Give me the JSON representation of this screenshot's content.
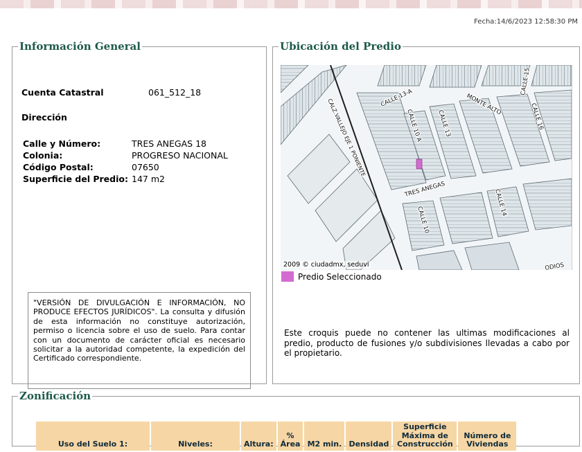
{
  "header": {
    "fecha": "Fecha:14/6/2023 12:58:30 PM"
  },
  "info": {
    "title": "Información General",
    "cuenta_label": "Cuenta Catastral",
    "cuenta_value": "061_512_18",
    "direccion_label": "Dirección",
    "fields": [
      {
        "label": "Calle y Número:",
        "value": "TRES ANEGAS 18"
      },
      {
        "label": "Colonia:",
        "value": "PROGRESO NACIONAL"
      },
      {
        "label": "Código Postal:",
        "value": "07650"
      },
      {
        "label": "Superficie del Predio:",
        "value": "147 m2"
      }
    ],
    "disclaimer": "\"VERSIÓN DE DIVULGACIÓN E INFORMACIÓN, NO PRODUCE EFECTOS JURÍDICOS\". La consulta y difusión de esta información no constituye autorización, permiso o licencia sobre el uso de suelo. Para contar con un documento de carácter oficial es necesario solicitar a la autoridad competente, la expedición del Certificado correspondiente."
  },
  "ubicacion": {
    "title": "Ubicación del Predio",
    "map_copyright": "2009 © ciudadmx, seduvi",
    "legend_label": "Predio Seleccionado",
    "croquis_note": "Este croquis puede no contener las ultimas modificaciones al predio, producto de fusiones y/o subdivisiones llevadas a cabo por el propietario.",
    "street_labels": [
      "CALLE 13-A",
      "CALLE 10 A",
      "CALLE 13",
      "MONTE ALTO",
      "CALLE 15",
      "CALLE 16",
      "CALZ.VALLEJO EJE 1 PONIENTE",
      "TRES ANEGAS",
      "CALLE 14",
      "CALLE 10",
      "ODIOS"
    ],
    "colors": {
      "predio": "#d36bd0",
      "blocks": "#c6d1d8",
      "streets": "#ffffff"
    }
  },
  "zonificacion": {
    "title": "Zonificación",
    "columns": [
      "Uso del Suelo 1:",
      "Niveles:",
      "Altura:",
      "% Área",
      "M2 min.",
      "Densidad",
      "Superficie Máxima de Construcción",
      "Número de Viviendas"
    ]
  }
}
